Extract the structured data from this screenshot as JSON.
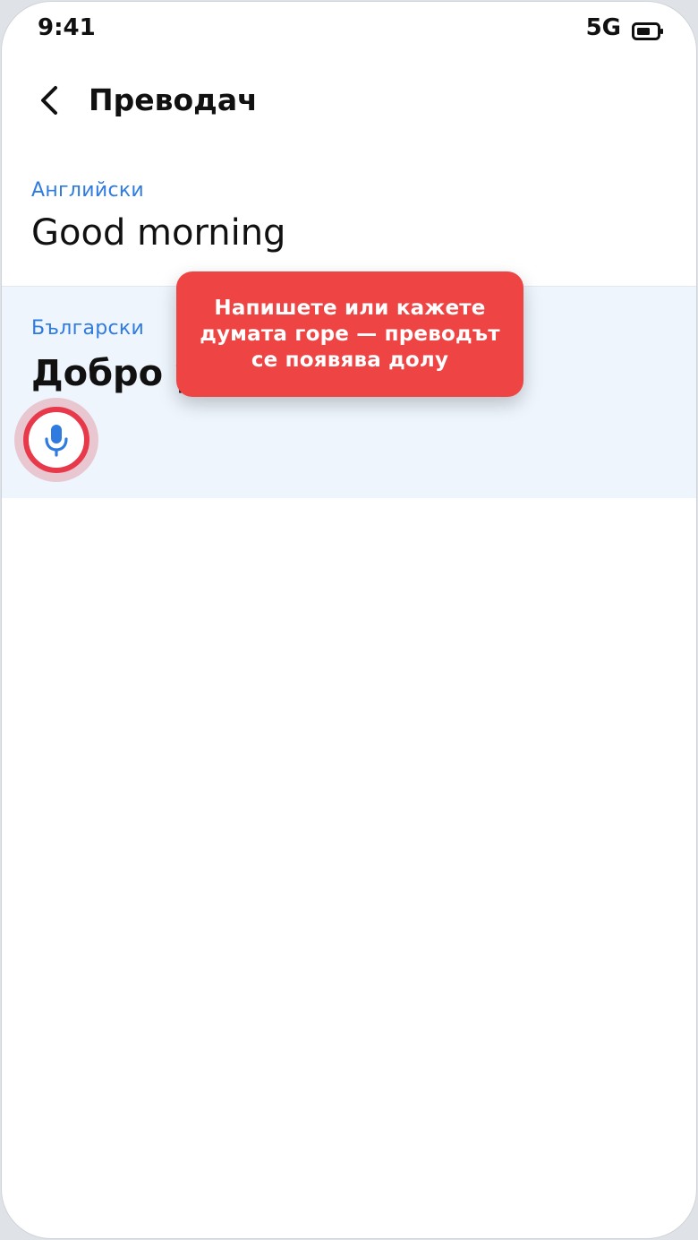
{
  "status_bar": {
    "time": "9:41",
    "network": "5G",
    "battery_icon": "battery-icon"
  },
  "header": {
    "back_icon": "chevron-left-icon",
    "title": "Преводач"
  },
  "source": {
    "language": "Английски",
    "text": "Good morning"
  },
  "target": {
    "language": "Български",
    "text": "Добро утро",
    "mic_icon": "microphone-icon"
  },
  "tooltip": {
    "text": "Напишете или кажете думата горе — преводът се появява долу"
  },
  "colors": {
    "accent": "#2f7be0",
    "tooltip_bg": "#ef4444",
    "highlight_ring": "#e8394a",
    "target_panel_bg": "#eef5fd"
  }
}
